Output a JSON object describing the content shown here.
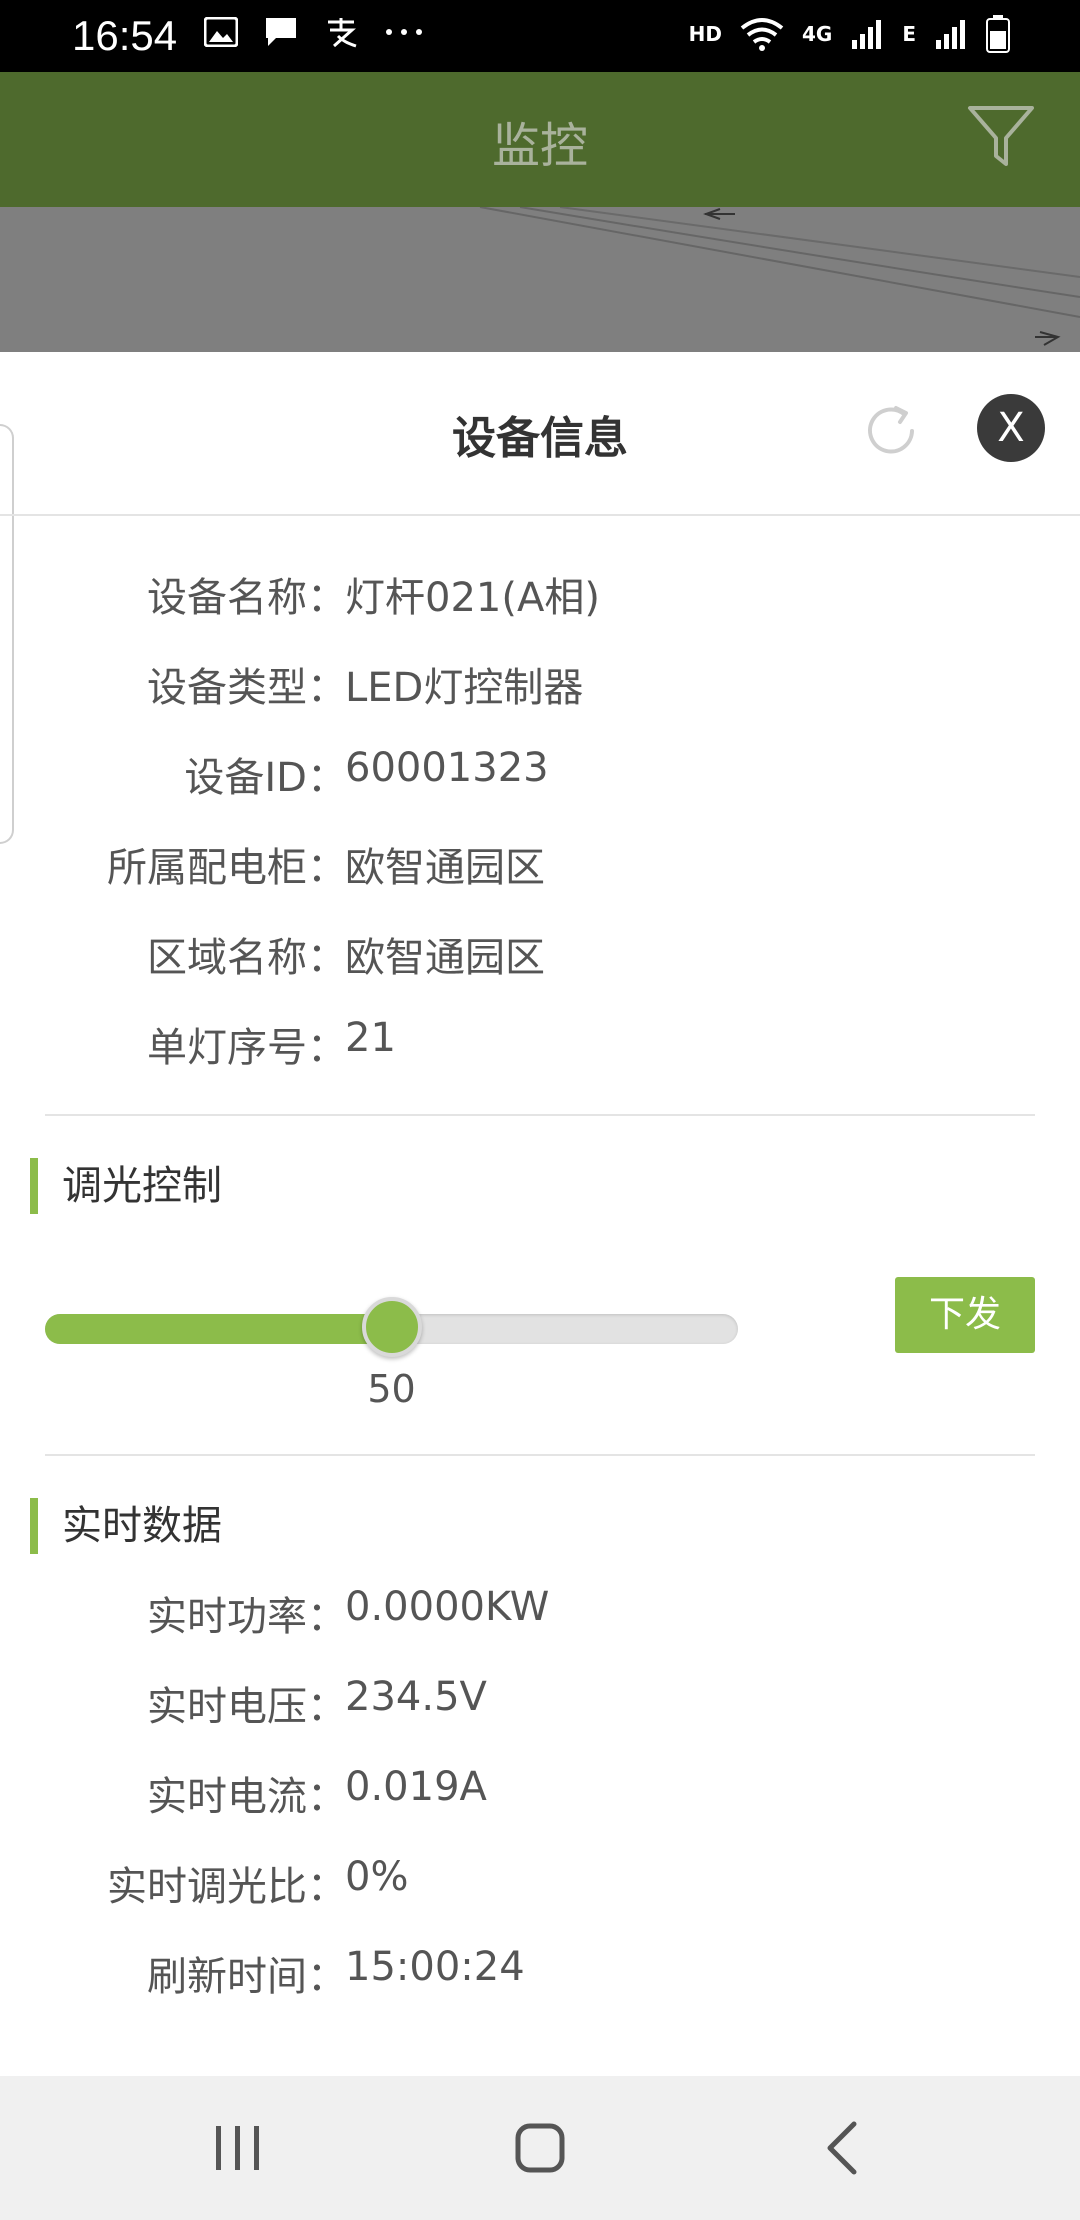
{
  "status_bar": {
    "time": "16:54",
    "icons_left": [
      "image-icon",
      "message-icon",
      "alipay-icon",
      "more-icon"
    ],
    "icons_right": [
      "hd-icon",
      "wifi-icon",
      "4g-signal-icon",
      "e-signal-icon",
      "battery-icon"
    ],
    "hd_label": "HD",
    "fourg_label": "4G",
    "e_label": "E"
  },
  "header": {
    "title": "监控",
    "filter_icon": "filter-icon"
  },
  "sheet": {
    "title": "设备信息",
    "refresh_icon": "refresh-icon",
    "close_label": "X"
  },
  "device_info": {
    "rows": [
      {
        "label": "设备名称：",
        "value": "灯杆021(A相)"
      },
      {
        "label": "设备类型：",
        "value": "LED灯控制器"
      },
      {
        "label": "设备ID：",
        "value": "60001323"
      },
      {
        "label": "所属配电柜：",
        "value": "欧智通园区"
      },
      {
        "label": "区域名称：",
        "value": "欧智通园区"
      },
      {
        "label": "单灯序号：",
        "value": "21"
      }
    ]
  },
  "dimming": {
    "section_title": "调光控制",
    "value": 50,
    "max": 100,
    "value_label": "50",
    "send_label": "下发",
    "accent_color": "#8cbc4a"
  },
  "realtime": {
    "section_title": "实时数据",
    "rows": [
      {
        "label": "实时功率：",
        "value": "0.0000KW"
      },
      {
        "label": "实时电压：",
        "value": "234.5V"
      },
      {
        "label": "实时电流：",
        "value": "0.019A"
      },
      {
        "label": "实时调光比：",
        "value": "0%"
      },
      {
        "label": "刷新时间：",
        "value": "15:00:24"
      }
    ]
  },
  "nav_bar": {
    "recents_icon": "recents-icon",
    "home_icon": "home-icon",
    "back_icon": "back-icon"
  }
}
